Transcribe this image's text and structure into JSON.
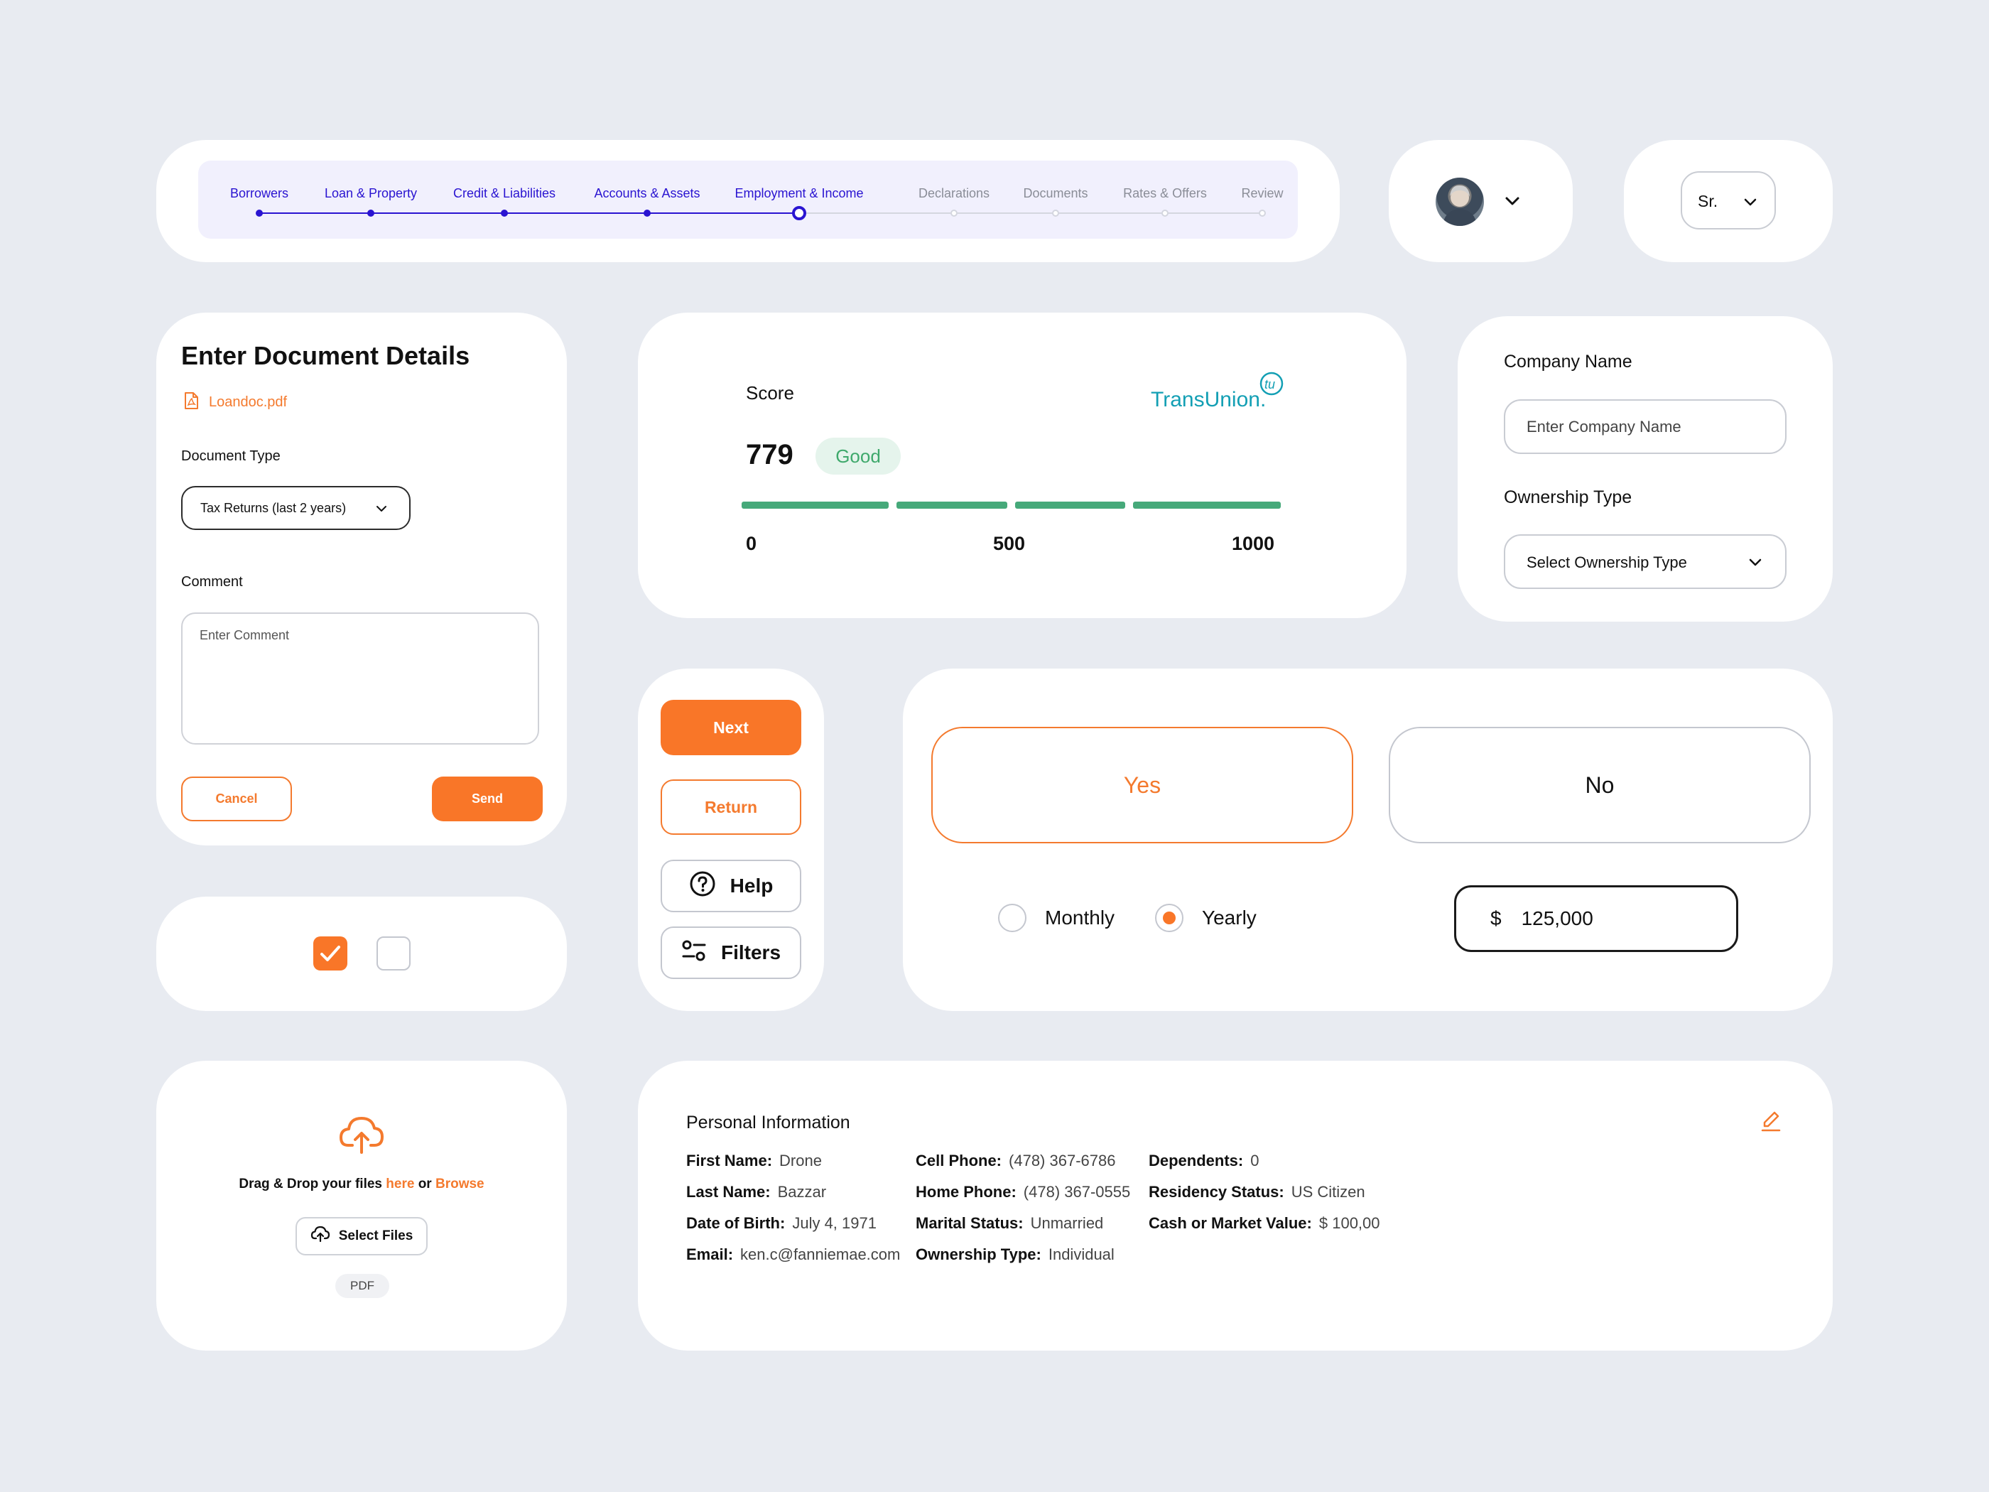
{
  "stepper": {
    "steps": [
      {
        "label": "Borrowers",
        "state": "done"
      },
      {
        "label": "Loan & Property",
        "state": "done"
      },
      {
        "label": "Credit & Liabilities",
        "state": "done"
      },
      {
        "label": "Accounts & Assets",
        "state": "done"
      },
      {
        "label": "Employment & Income",
        "state": "current"
      },
      {
        "label": "Declarations",
        "state": "todo"
      },
      {
        "label": "Documents",
        "state": "todo"
      },
      {
        "label": "Rates & Offers",
        "state": "todo"
      },
      {
        "label": "Review",
        "state": "todo"
      }
    ],
    "active_color": "#2a14d1"
  },
  "profile": {
    "avatar_icon": "user-avatar",
    "title_select_value": "Sr."
  },
  "document_form": {
    "title": "Enter Document Details",
    "file_name": "Loandoc.pdf",
    "file_icon": "pdf-file-icon",
    "document_type_label": "Document Type",
    "document_type_value": "Tax Returns (last 2 years)",
    "comment_label": "Comment",
    "comment_placeholder": "Enter Comment",
    "cancel_label": "Cancel",
    "send_label": "Send"
  },
  "checkboxes": {
    "first_checked": true,
    "second_checked": false
  },
  "upload": {
    "text_before": "Drag & Drop your files ",
    "here_link": "here",
    "text_middle": " or ",
    "browse_link": "Browse",
    "select_files_label": "Select Files",
    "file_type_badge": "PDF"
  },
  "score": {
    "label": "Score",
    "value": "779",
    "rating": "Good",
    "provider_logo": "TransUnion",
    "ticks": [
      "0",
      "500",
      "1000"
    ],
    "min": 0,
    "max": 1000,
    "filled_color": "#46a97a",
    "empty_color": "#cbcbcb"
  },
  "company": {
    "name_label": "Company Name",
    "name_placeholder": "Enter Company Name",
    "ownership_label": "Ownership Type",
    "ownership_placeholder": "Select Ownership Type"
  },
  "actions": {
    "next_label": "Next",
    "return_label": "Return",
    "help_label": "Help",
    "filters_label": "Filters"
  },
  "choice": {
    "yes_label": "Yes",
    "no_label": "No",
    "selected": "Yes",
    "frequency_options": [
      "Monthly",
      "Yearly"
    ],
    "frequency_selected": "Yearly",
    "currency_symbol": "$",
    "amount": "125,000"
  },
  "personal_info": {
    "title": "Personal Information",
    "columns": [
      [
        {
          "label": "First Name:",
          "value": "Drone"
        },
        {
          "label": "Last Name:",
          "value": "Bazzar"
        },
        {
          "label": "Date of Birth:",
          "value": "July 4, 1971"
        },
        {
          "label": "Email:",
          "value": "ken.c@fanniemae.com"
        }
      ],
      [
        {
          "label": "Cell Phone:",
          "value": "(478) 367-6786"
        },
        {
          "label": "Home Phone:",
          "value": "(478) 367-0555"
        },
        {
          "label": "Marital Status:",
          "value": "Unmarried"
        },
        {
          "label": "Ownership Type:",
          "value": "Individual"
        }
      ],
      [
        {
          "label": "Dependents:",
          "value": "0"
        },
        {
          "label": "Residency Status:",
          "value": "US Citizen"
        },
        {
          "label": "Cash or Market Value:",
          "value": "$ 100,00"
        }
      ]
    ]
  },
  "colors": {
    "accent": "#f97628",
    "background": "#e8ebf1"
  }
}
